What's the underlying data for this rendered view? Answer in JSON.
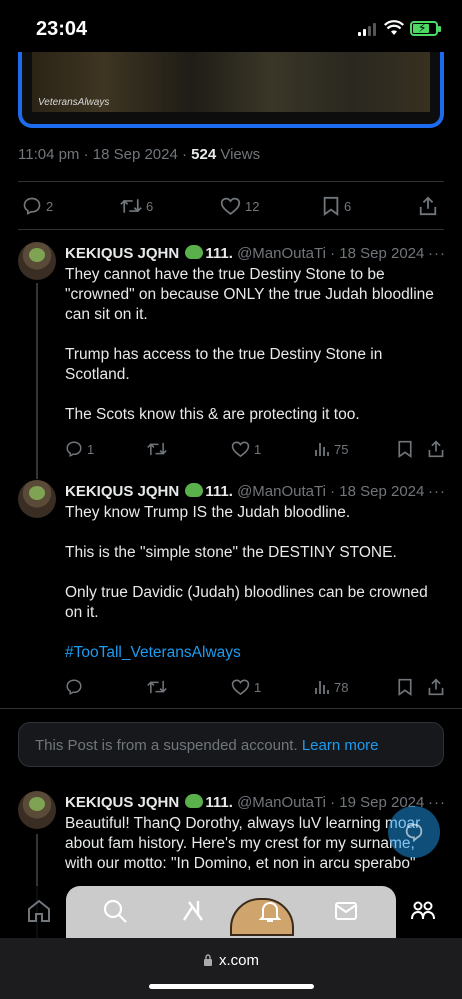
{
  "status_bar": {
    "time": "23:04"
  },
  "media": {
    "caption": "VeteransAlways"
  },
  "post": {
    "timestamp": "11:04 pm · 18 Sep 2024 · ",
    "views_count": "524",
    "views_label": " Views",
    "stats": {
      "replies": "2",
      "reposts": "6",
      "likes": "12",
      "bookmarks": "6"
    }
  },
  "replies": [
    {
      "name": "KEKIQUS JQHN",
      "name_suffix": "111.",
      "handle": "@ManOutaTi",
      "date": "· 18 Sep 2024",
      "paragraphs": [
        "They cannot have the true Destiny Stone to be \"crowned\" on because ONLY the true Judah bloodline can sit on it.",
        "Trump has access to the true Destiny Stone in Scotland.",
        "The Scots know this & are protecting it too."
      ],
      "stats": {
        "replies": "1",
        "reposts": "",
        "likes": "1",
        "views": "75"
      }
    },
    {
      "name": "KEKIQUS JQHN",
      "name_suffix": "111.",
      "handle": "@ManOutaTi",
      "date": "· 18 Sep 2024",
      "paragraphs": [
        "They know Trump IS the Judah bloodline.",
        "This is the \"simple stone\" the DESTINY STONE.",
        "Only true Davidic (Judah) bloodlines can be crowned on it."
      ],
      "hashtag": "#TooTall_VeteransAlways",
      "stats": {
        "replies": "",
        "reposts": "",
        "likes": "1",
        "views": "78"
      }
    },
    {
      "name": "KEKIQUS JQHN",
      "name_suffix": "111.",
      "handle": "@ManOutaTi",
      "date": "· 19 Sep 2024",
      "paragraphs": [
        "Beautiful! ThanQ Dorothy, always luV learning moar about fam history. Here's my crest for my surname, with our motto: \"In Domino, et non in arcu sperabo\""
      ]
    }
  ],
  "suspended": {
    "text": "This Post is from a suspended account. ",
    "link": "Learn more"
  },
  "more_glyph": "···",
  "browser": {
    "url": "x.com"
  }
}
